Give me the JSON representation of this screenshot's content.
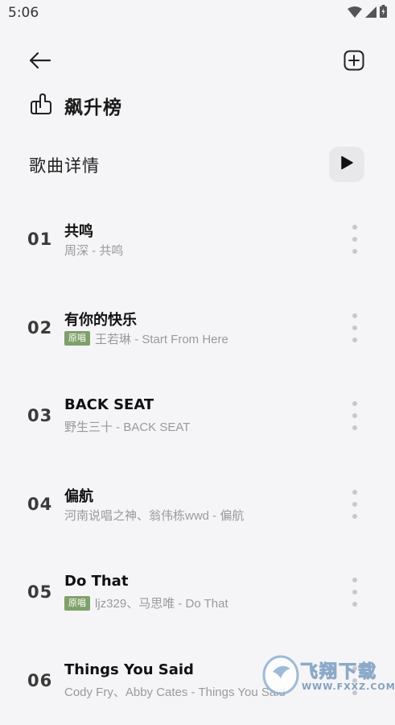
{
  "status_bar": {
    "time": "5:06"
  },
  "header": {
    "chart_title": "飙升榜",
    "section_title": "歌曲详情"
  },
  "icons": {
    "back": "arrow-left-icon",
    "add": "add-square-icon",
    "chart": "hand-icon",
    "play": "play-icon",
    "more": "more-vertical-icon"
  },
  "badge_label": "原唱",
  "songs": [
    {
      "rank": "01",
      "title": "共鸣",
      "artist": "周深 - 共鸣",
      "original": false
    },
    {
      "rank": "02",
      "title": "有你的快乐",
      "artist": "王若琳 - Start From Here",
      "original": true
    },
    {
      "rank": "03",
      "title": "BACK SEAT",
      "artist": "野生三十 - BACK SEAT",
      "original": false
    },
    {
      "rank": "04",
      "title": "偏航",
      "artist": "河南说唱之神、翁伟栋wwd - 偏航",
      "original": false
    },
    {
      "rank": "05",
      "title": "Do That",
      "artist": "ljz329、马思唯 - Do That",
      "original": true
    },
    {
      "rank": "06",
      "title": "Things You Said",
      "artist": "Cody Fry、Abby Cates - Things You Said",
      "original": false
    }
  ],
  "watermark": {
    "text": "飞翔下载",
    "url": "WWW.FXXZ.COM"
  },
  "colors": {
    "background": "#f5f5f7",
    "badge": "#7fa06a",
    "muted": "#9a9a9a"
  }
}
